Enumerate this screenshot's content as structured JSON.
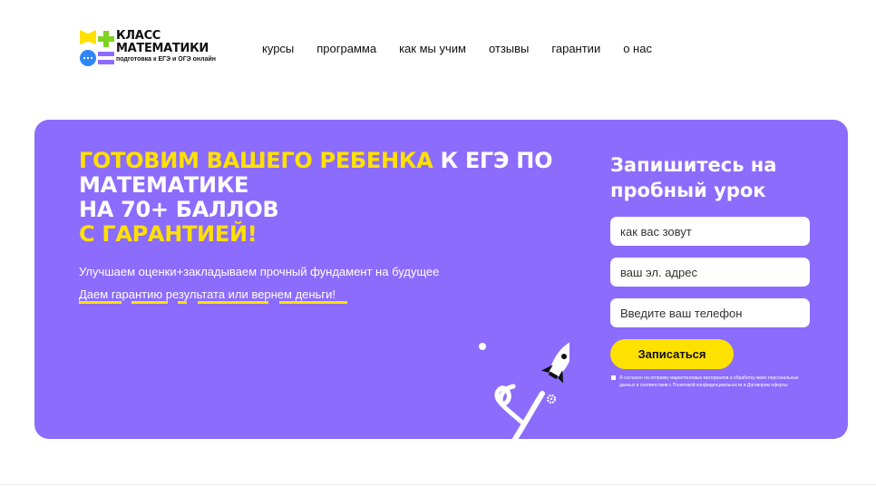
{
  "logo": {
    "line1": "КЛАСС",
    "line2": "МАТЕМАТИКИ",
    "tagline": "подготовка к ЕГЭ и ОГЭ онлайн"
  },
  "nav": {
    "items": [
      "курсы",
      "программа",
      "как мы учим",
      "отзывы",
      "гарантии",
      "о нас"
    ]
  },
  "hero": {
    "headline_yellow_1": "ГОТОВИМ ВАШЕГО РЕБЕНКА",
    "headline_white_1": " К ЕГЭ ПО МАТЕМАТИКЕ",
    "headline_white_2": "НА 70+ БАЛЛОВ",
    "headline_yellow_2": "С ГАРАНТИЕЙ!",
    "subtitle": "Улучшаем оценки+закладываем прочный фундамент на будущее",
    "guarantee": "Даем гарантию результата или вернем деньги!"
  },
  "form": {
    "title": "Запишитесь на пробный урок",
    "name_placeholder": "как вас зовут",
    "email_placeholder": "ваш эл. адрес",
    "phone_placeholder": "Введите ваш телефон",
    "submit_label": "Записаться",
    "consent_text": "Я согласен на отправку маркетинговых материалов и обработку моих персональных данных в соответствии с Политикой конфиденциальности и Договором оферты"
  },
  "colors": {
    "hero_bg": "#8C6CFC",
    "accent_yellow": "#FFE100",
    "logo_green": "#7ED321",
    "logo_blue": "#2F86F6"
  },
  "icons": [
    "logo-book-icon",
    "logo-plus-icon",
    "logo-chat-icon",
    "logo-equals-icon",
    "rocket-icon",
    "gear-icon"
  ]
}
